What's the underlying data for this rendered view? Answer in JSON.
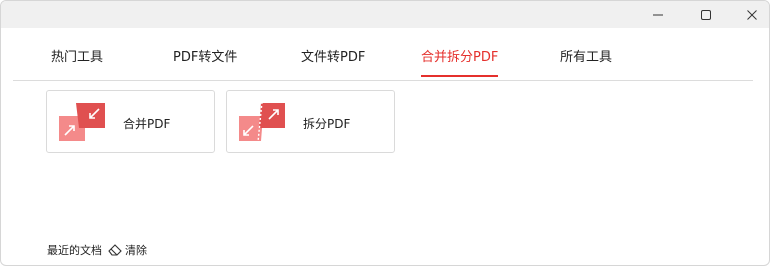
{
  "window": {
    "controls": {
      "minimize_icon": "minimize-icon",
      "maximize_icon": "maximize-icon",
      "close_icon": "close-icon"
    }
  },
  "tabs": [
    {
      "label": "热门工具",
      "active": false
    },
    {
      "label": "PDF转文件",
      "active": false
    },
    {
      "label": "文件转PDF",
      "active": false
    },
    {
      "label": "合并拆分PDF",
      "active": true
    },
    {
      "label": "所有工具",
      "active": false
    }
  ],
  "tools": [
    {
      "label": "合并PDF",
      "icon": "merge-pdf-icon"
    },
    {
      "label": "拆分PDF",
      "icon": "split-pdf-icon"
    }
  ],
  "recent": {
    "label": "最近的文档",
    "clear_label": "清除",
    "clear_icon": "eraser-icon"
  },
  "colors": {
    "accent": "#e5302c",
    "icon_dark": "#e05050",
    "icon_light": "#f48a8a",
    "titlebar": "#f0f0f0",
    "divider": "#dcdcdc"
  }
}
